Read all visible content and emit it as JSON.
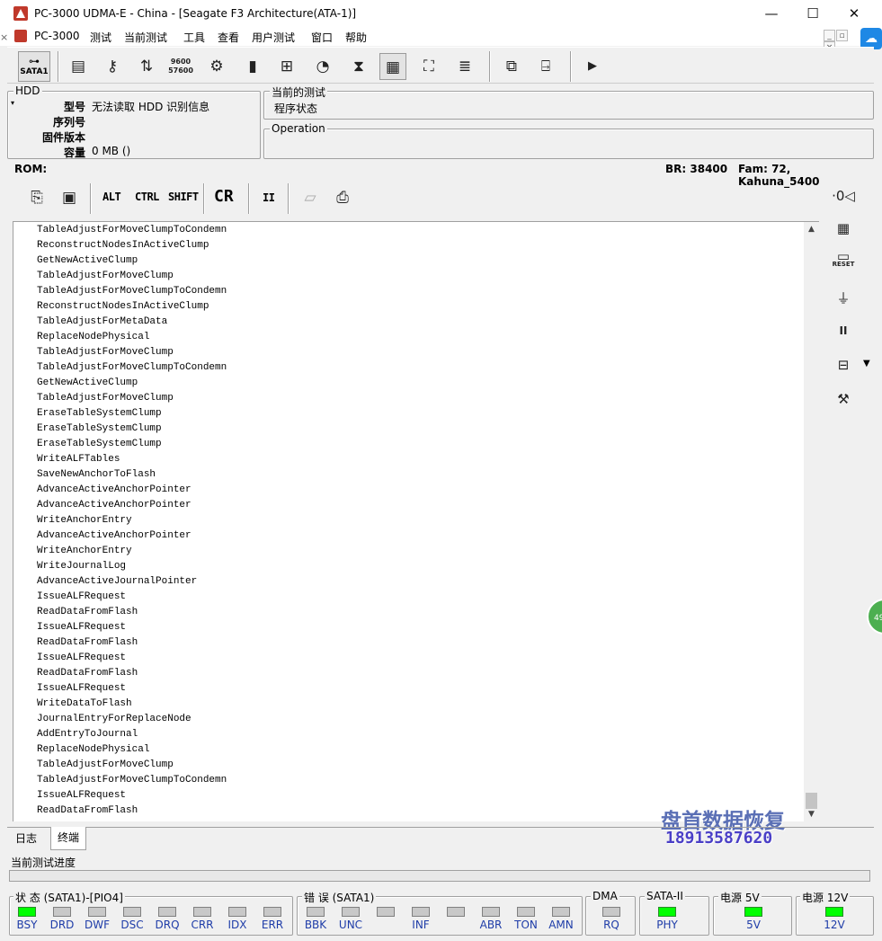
{
  "window": {
    "title": "PC-3000 UDMA-E - China - [Seagate F3 Architecture(ATA-1)]",
    "controls": {
      "minimize": "—",
      "maximize": "☐",
      "close": "✕"
    }
  },
  "menu": {
    "items": [
      "PC-3000",
      "测试",
      "当前测试",
      "工具",
      "查看",
      "用户测试",
      "窗口",
      "帮助"
    ]
  },
  "toolbar": {
    "sata_label": "SATA1",
    "baud_top": "9600",
    "baud_bottom": "57600"
  },
  "hdd_panel": {
    "title": "HDD",
    "rows": [
      {
        "label": "型号",
        "value": "无法读取 HDD 识别信息"
      },
      {
        "label": "序列号",
        "value": ""
      },
      {
        "label": "固件版本",
        "value": ""
      },
      {
        "label": "容量",
        "value": "0 MB ()"
      }
    ]
  },
  "current_test": {
    "title": "当前的测试",
    "value": "程序状态"
  },
  "operation": {
    "title": "Operation"
  },
  "rom_bar": {
    "rom_label": "ROM:",
    "br": "BR: 38400",
    "fam": "Fam: 72, Kahuna_5400"
  },
  "terminal_toolbar": {
    "alt": "ALT",
    "ctrl": "CTRL",
    "shift": "SHIFT",
    "cr": "CR",
    "pause": "II"
  },
  "terminal": {
    "lines": [
      "TableAdjustForMoveClumpToCondemn",
      "ReconstructNodesInActiveClump",
      "GetNewActiveClump",
      "TableAdjustForMoveClump",
      "TableAdjustForMoveClumpToCondemn",
      "ReconstructNodesInActiveClump",
      "TableAdjustForMetaData",
      "ReplaceNodePhysical",
      "TableAdjustForMoveClump",
      "TableAdjustForMoveClumpToCondemn",
      "GetNewActiveClump",
      "TableAdjustForMoveClump",
      "EraseTableSystemClump",
      "EraseTableSystemClump",
      "EraseTableSystemClump",
      "WriteALFTables",
      "SaveNewAnchorToFlash",
      "AdvanceActiveAnchorPointer",
      "AdvanceActiveAnchorPointer",
      "WriteAnchorEntry",
      "AdvanceActiveAnchorPointer",
      "WriteAnchorEntry",
      "WriteJournalLog",
      "AdvanceActiveJournalPointer",
      "IssueALFRequest",
      "ReadDataFromFlash",
      "IssueALFRequest",
      "ReadDataFromFlash",
      "IssueALFRequest",
      "ReadDataFromFlash",
      "IssueALFRequest",
      "WriteDataToFlash",
      "JournalEntryForReplaceNode",
      "AddEntryToJournal",
      "ReplaceNodePhysical",
      "TableAdjustForMoveClump",
      "TableAdjustForMoveClumpToCondemn",
      "IssueALFRequest",
      "ReadDataFromFlash"
    ]
  },
  "right_panel": {
    "reset_label": "RESET",
    "pause": "II"
  },
  "watermark": {
    "name": "盘首数据恢复",
    "phone": "18913587620"
  },
  "side_badge": "49",
  "tabs": {
    "log": "日志",
    "terminal": "终端"
  },
  "progress": {
    "label": "当前测试进度"
  },
  "status": {
    "state_title": "状 态 (SATA1)-[PIO4]",
    "state_leds": [
      {
        "name": "BSY",
        "on": true
      },
      {
        "name": "DRD",
        "on": false
      },
      {
        "name": "DWF",
        "on": false
      },
      {
        "name": "DSC",
        "on": false
      },
      {
        "name": "DRQ",
        "on": false
      },
      {
        "name": "CRR",
        "on": false
      },
      {
        "name": "IDX",
        "on": false
      },
      {
        "name": "ERR",
        "on": false
      }
    ],
    "error_title": "错 误 (SATA1)",
    "error_leds": [
      {
        "name": "BBK",
        "on": false
      },
      {
        "name": "UNC",
        "on": false
      },
      {
        "name": "",
        "on": false
      },
      {
        "name": "INF",
        "on": false
      },
      {
        "name": "",
        "on": false
      },
      {
        "name": "ABR",
        "on": false
      },
      {
        "name": "TON",
        "on": false
      },
      {
        "name": "AMN",
        "on": false
      }
    ],
    "dma_title": "DMA",
    "dma_led": {
      "name": "RQ",
      "on": false
    },
    "sata2_title": "SATA-II",
    "sata2_led": {
      "name": "PHY",
      "on": true
    },
    "p5_title": "电源 5V",
    "p5_led": {
      "name": "5V",
      "on": true
    },
    "p12_title": "电源 12V",
    "p12_led": {
      "name": "12V",
      "on": true
    },
    "led_on_color": "#00ff00",
    "label_color": "#1e3ca8"
  }
}
